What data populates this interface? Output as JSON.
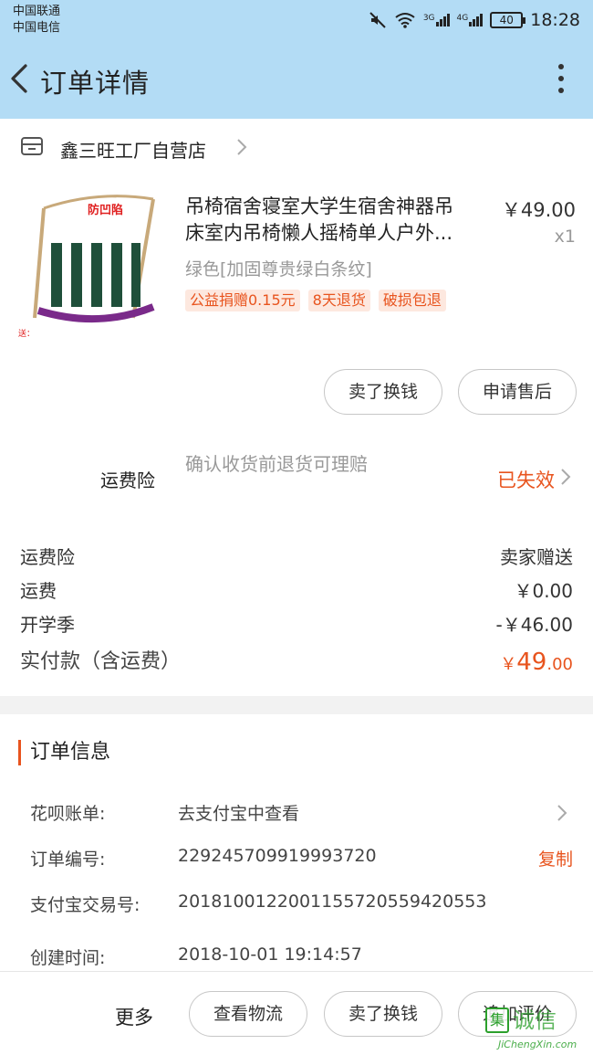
{
  "status_bar": {
    "carrier_1": "中国联通",
    "carrier_2": "中国电信",
    "network_1": "3G",
    "network_2": "4G",
    "battery": "40",
    "time": "18:28"
  },
  "header": {
    "title": "订单详情"
  },
  "shop": {
    "name": "鑫三旺工厂自营店"
  },
  "product": {
    "title_line1": "吊椅宿舍寝室大学生宿舍神器吊",
    "title_line2": "床室内吊椅懒人摇椅单人户外...",
    "price": "￥49.00",
    "quantity": "x1",
    "sku": "绿色[加固尊贵绿白条纹]",
    "tags": [
      "公益捐赠0.15元",
      "8天退货",
      "破损包退"
    ],
    "image_badge": "防凹陷",
    "image_caption": "送："
  },
  "item_actions": {
    "sell_label": "卖了换钱",
    "after_sale_label": "申请售后"
  },
  "insurance": {
    "label": "运费险",
    "description": "确认收货前退货可理赔",
    "status": "已失效"
  },
  "fees": [
    {
      "label": "运费险",
      "value": "卖家赠送"
    },
    {
      "label": "运费",
      "value": "￥0.00"
    },
    {
      "label": "开学季",
      "value": "-￥46.00"
    }
  ],
  "paid": {
    "label": "实付款（含运费）",
    "currency": "￥",
    "integer": "49",
    "decimal": ".00"
  },
  "order_info": {
    "heading": "订单信息",
    "rows": [
      {
        "key": "花呗账单:",
        "value": "去支付宝中查看",
        "action": ""
      },
      {
        "key": "订单编号:",
        "value": "229245709919993720",
        "action": "复制"
      },
      {
        "key": "支付宝交易号:",
        "value": "2018100122001155720559420553",
        "action": ""
      },
      {
        "key": "创建时间:",
        "value": "2018-10-01 19:14:57",
        "action": ""
      }
    ]
  },
  "bottom_bar": {
    "more_label": "更多",
    "logistics_label": "查看物流",
    "sell_label": "卖了换钱",
    "review_label": "追加评价"
  },
  "watermark": {
    "logo_char": "集",
    "text": "诚信",
    "sub": "JiChengXin.com"
  },
  "colors": {
    "accent": "#e8541e",
    "header_bg": "#b3dcf5"
  }
}
